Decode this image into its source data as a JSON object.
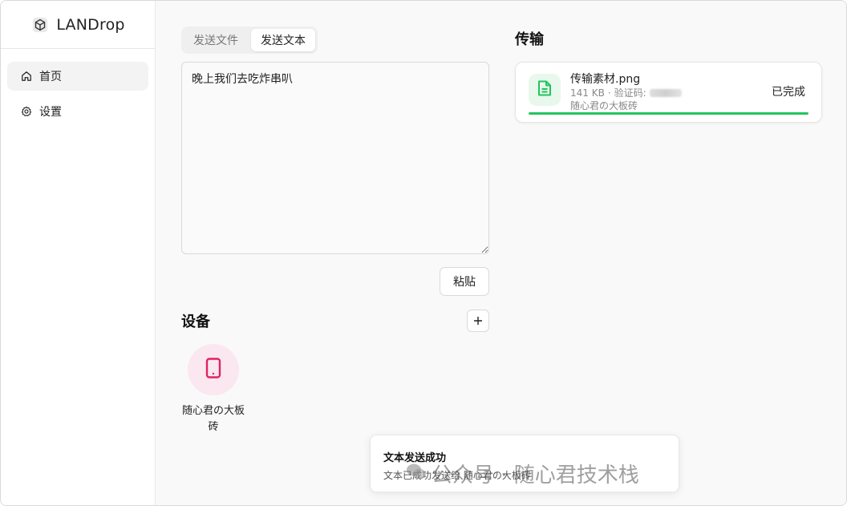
{
  "app": {
    "title": "LANDrop"
  },
  "sidebar": {
    "items": [
      {
        "label": "首页",
        "icon": "home-icon",
        "active": true
      },
      {
        "label": "设置",
        "icon": "gear-icon",
        "active": false
      }
    ]
  },
  "send": {
    "tabs": [
      {
        "label": "发送文件",
        "active": false
      },
      {
        "label": "发送文本",
        "active": true
      }
    ],
    "text_value": "晚上我们去吃炸串叭",
    "paste_label": "粘贴"
  },
  "devices": {
    "title": "设备",
    "add_icon": "plus-icon",
    "items": [
      {
        "name": "随心君の大板砖",
        "icon": "phone-icon",
        "color": "#e0245e"
      }
    ]
  },
  "transfers": {
    "title": "传输",
    "items": [
      {
        "file_name": "传输素材.png",
        "size": "141 KB",
        "code_label": "验证码:",
        "device": "随心君の大板砖",
        "status": "已完成",
        "progress": 1.0,
        "icon": "file-text-icon",
        "accent": "#22c55e"
      }
    ]
  },
  "toast": {
    "title": "文本发送成功",
    "description": "文本已成功发送给 随心君の大板砖"
  },
  "watermark": {
    "text": "公众号 · 随心君技术栈"
  }
}
